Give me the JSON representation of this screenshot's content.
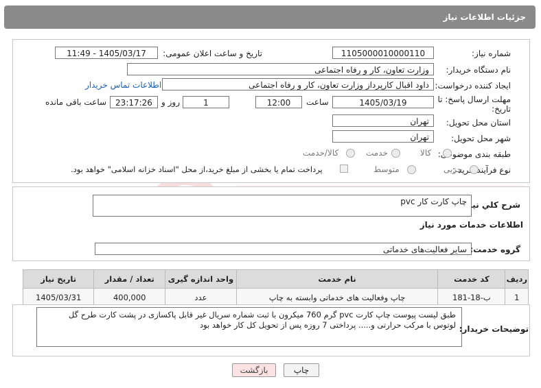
{
  "header": {
    "title": "جزئیات اطلاعات نیاز"
  },
  "form": {
    "need_number_label": "شماره نیاز:",
    "need_number": "1105000010000110",
    "announce_label": "تاریخ و ساعت اعلان عمومی:",
    "announce_value": "1405/03/17 - 11:49",
    "buyer_org_label": "نام دستگاه خریدار:",
    "buyer_org": "وزارت تعاون، کار و رفاه اجتماعی",
    "requester_label": "ایجاد کننده درخواست:",
    "requester": "داود اقبال کارپرداز وزارت تعاون، کار و رفاه اجتماعی",
    "contact_link": "اطلاعات تماس خریدار",
    "deadline_label_1": "مهلت ارسال پاسخ: تا",
    "deadline_label_2": "تاریخ:",
    "deadline_date": "1405/03/19",
    "hour_label": "ساعت",
    "deadline_hour": "12:00",
    "days": "1",
    "day_label": "روز و",
    "remaining_time": "23:17:26",
    "remaining_label": "ساعت باقی مانده",
    "province_label": "استان محل تحویل:",
    "province": "تهران",
    "city_label": "شهر محل تحویل:",
    "city": "تهران",
    "category_label": "طبقه بندی موضوعی:",
    "category_options": [
      "کالا",
      "خدمت",
      "کالا/خدمت"
    ],
    "process_label": "نوع فرآیند خرید :",
    "process_options": [
      "جزیی",
      "متوسط"
    ],
    "treasury_note": "پرداخت تمام یا بخشی از مبلغ خرید،از محل \"اسناد خزانه اسلامی\" خواهد بود."
  },
  "summary": {
    "label": "شرح کلي نياز:",
    "value": "چاپ کارت کار pvc"
  },
  "services": {
    "section_title": "اطلاعات خدمات مورد نیاز",
    "group_label": "گروه خدمت:",
    "group_value": "سایر فعالیت‌های خدماتی",
    "columns": [
      "ردیف",
      "کد خدمت",
      "نام خدمت",
      "واحد اندازه گیری",
      "تعداد / مقدار",
      "تاریخ نیاز"
    ],
    "rows": [
      [
        "1",
        "ب-18-181",
        "چاپ وفعالیت های خدماتی وابسته به چاپ",
        "عدد",
        "400,000",
        "1405/03/31"
      ]
    ]
  },
  "buyer_notes": {
    "label": "توضیحات خریدار:",
    "line1": "طبق لیست پیوست    چاپ کارت pvc گرم  760  میکرون با ثبت شماره سریال غیر قابل پاکسازی در پشت کارت طرح گل",
    "line2": "لوتوس  با مرکب حرارتی و.....     پرداختی 7 روزه پس از تحویل کل کار خواهد بود"
  },
  "buttons": {
    "print": "چاپ",
    "back": "بازگشت"
  },
  "colors": {
    "header_bg": "#8a8a8a",
    "link": "#1a5fb4",
    "back_button_bg": "#fbe3e3"
  }
}
